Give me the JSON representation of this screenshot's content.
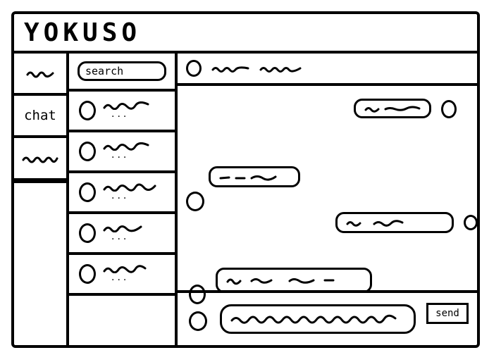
{
  "app": {
    "title": "YOKUSO"
  },
  "nav": {
    "items": [
      {
        "label": ""
      },
      {
        "label": "chat"
      },
      {
        "label": ""
      }
    ]
  },
  "contacts": {
    "search_label": "search"
  },
  "compose": {
    "send_label": "send"
  }
}
